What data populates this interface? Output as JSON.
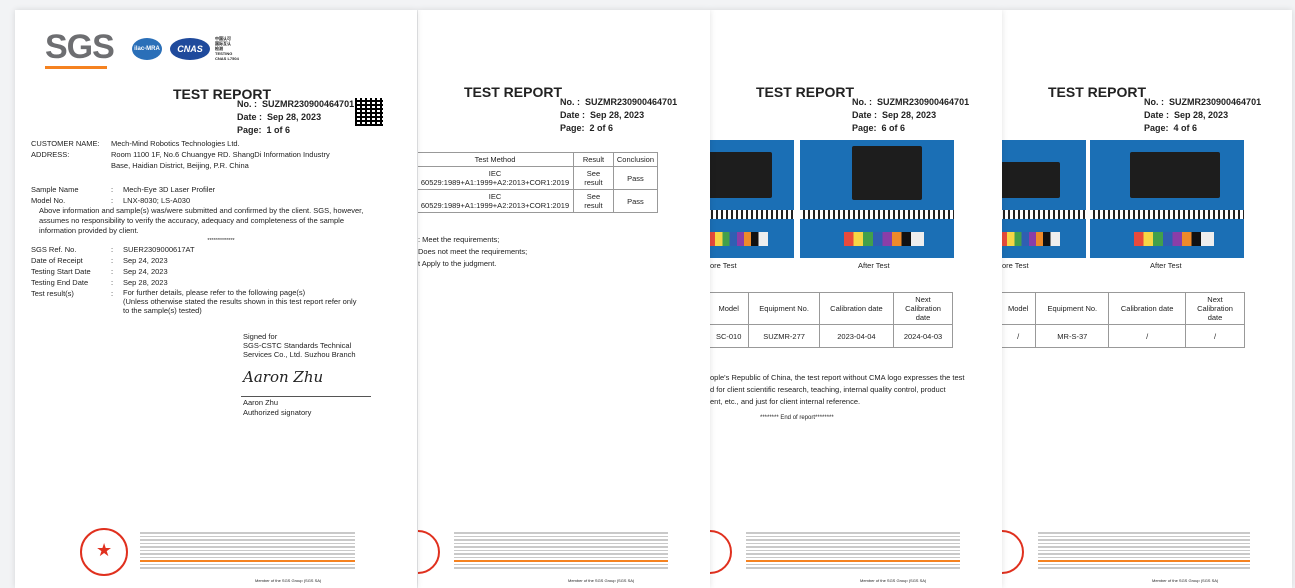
{
  "p1": {
    "logo": "SGS",
    "ilac": "ilac-MRA",
    "cnas": "CNAS",
    "cnas_sub": [
      "中国认可",
      "国际互认",
      "检测",
      "TESTING",
      "CNAS L7504"
    ],
    "title": "TEST REPORT",
    "no_label": "No. :",
    "no": "SUZMR230900464701",
    "date_label": "Date :",
    "date": "Sep 28, 2023",
    "page_label": "Page:",
    "page": "1 of 6",
    "customer_label": "CUSTOMER NAME:",
    "customer": "Mech-Mind Robotics Technologies Ltd.",
    "address_label": "ADDRESS:",
    "address1": "Room 1100 1F, No.6 Chuangye RD. ShangDi Information Industry",
    "address2": "Base, Haidian District, Beijing, P.R. China",
    "sample_label": "Sample Name",
    "sample": "Mech-Eye 3D Laser Profiler",
    "model_label": "Model No.",
    "model": "LNX-8030; LS-A030",
    "para1": "Above information and sample(s) was/were submitted and confirmed by the client. SGS, however,",
    "para2": "assumes no responsibility to verify the accuracy, adequacy and completeness of the sample",
    "para3": "information provided by client.",
    "stars": "**************",
    "ref_label": "SGS Ref. No.",
    "ref": "SUER2309000617AT",
    "receipt_label": "Date of Receipt",
    "receipt": "Sep 24, 2023",
    "start_label": "Testing Start Date",
    "start": "Sep 24, 2023",
    "end_label": "Testing End Date",
    "end": "Sep 28, 2023",
    "result_label": "Test result(s)",
    "result1": "For further details, please refer to the following page(s)",
    "result2": "(Unless otherwise stated the results shown in this test report refer only",
    "result3": "to the sample(s) tested)",
    "signed1": "Signed for",
    "signed2": "SGS-CSTC Standards Technical",
    "signed3": "Services Co., Ltd.  Suzhou Branch",
    "signature": "Aaron Zhu",
    "signer": "Aaron Zhu",
    "signer_title": "Authorized signatory"
  },
  "p2": {
    "title": "TEST REPORT",
    "no_label": "No. :",
    "no": "SUZMR230900464701",
    "date_label": "Date :",
    "date": "Sep 28, 2023",
    "page_label": "Page:",
    "page": "2 of 6",
    "headers": [
      "Test Method",
      "Result",
      "Conclusion"
    ],
    "rows": [
      {
        "method1": "IEC",
        "method2": "60529:1989+A1:1999+A2:2013+COR1:2019",
        "result": "See result",
        "conclusion": "Pass"
      },
      {
        "method1": "IEC",
        "method2": "60529:1989+A1:1999+A2:2013+COR1:2019",
        "result": "See result",
        "conclusion": "Pass"
      }
    ],
    "note1": ": Meet the requirements;",
    "note2": "Does not meet the requirements;",
    "note3": "t Apply to the judgment."
  },
  "p3": {
    "title": "TEST REPORT",
    "no_label": "No. :",
    "no": "SUZMR230900464701",
    "date_label": "Date :",
    "date": "Sep 28, 2023",
    "page_label": "Page:",
    "page": "6 of 6",
    "caption_left": "ore Test",
    "caption_right": "After Test",
    "headers": [
      "Model",
      "Equipment No.",
      "Calibration date",
      "Next Calibration date"
    ],
    "row": [
      "SC-010",
      "SUZMR-277",
      "2023-04-04",
      "2024-04-03"
    ],
    "para1": "ople's Republic of China, the test report without CMA logo expresses the test",
    "para2": "d for client scientific research, teaching, internal quality control, product",
    "para3": "ent, etc., and just for client internal reference.",
    "end": "******** End of report********"
  },
  "p4": {
    "title": "TEST REPORT",
    "no_label": "No. :",
    "no": "SUZMR230900464701",
    "date_label": "Date :",
    "date": "Sep 28, 2023",
    "page_label": "Page:",
    "page": "4 of 6",
    "caption_left": "ore Test",
    "caption_right": "After Test",
    "headers": [
      "Model",
      "Equipment No.",
      "Calibration date",
      "Next Calibration date"
    ],
    "row": [
      "/",
      "MR-S-37",
      "/",
      "/"
    ]
  },
  "footer": {
    "member": "Member of the SGS Group (SGS SA)"
  },
  "colors": {
    "sgs_orange": "#f58220",
    "sgs_gray": "#6d6e71",
    "stamp_red": "#e0301e",
    "photo_blue": "#1b6fb5"
  }
}
